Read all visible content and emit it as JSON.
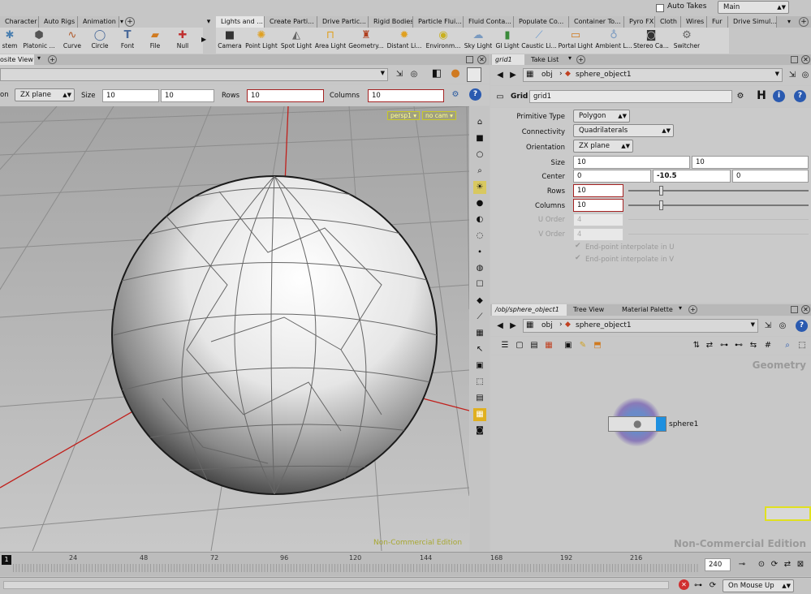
{
  "top_tabs_left": [
    "Character",
    "Auto Rigs",
    "Animation"
  ],
  "top_tabs_right": [
    "Lights and ...",
    "Create Parti...",
    "Drive Partic...",
    "Rigid Bodies",
    "Particle Flui...",
    "Fluid Conta...",
    "Populate Co...",
    "Container To...",
    "Pyro FX",
    "Cloth",
    "Wires",
    "Fur",
    "Drive Simul..."
  ],
  "auto_takes_label": "Auto Takes",
  "main_label": "Main",
  "tools_left": [
    {
      "label": "stem",
      "icon": "stem-icon"
    },
    {
      "label": "Platonic ...",
      "icon": "platonic-icon"
    },
    {
      "label": "Curve",
      "icon": "curve-icon"
    },
    {
      "label": "Circle",
      "icon": "circle-icon"
    },
    {
      "label": "Font",
      "icon": "font-icon"
    },
    {
      "label": "File",
      "icon": "file-icon"
    },
    {
      "label": "Null",
      "icon": "null-icon"
    }
  ],
  "tools_right": [
    {
      "label": "Camera",
      "icon": "camera-icon"
    },
    {
      "label": "Point Light",
      "icon": "point-light-icon"
    },
    {
      "label": "Spot Light",
      "icon": "spot-light-icon"
    },
    {
      "label": "Area Light",
      "icon": "area-light-icon"
    },
    {
      "label": "Geometry...",
      "icon": "geometry-light-icon"
    },
    {
      "label": "Distant Li...",
      "icon": "distant-light-icon"
    },
    {
      "label": "Environm...",
      "icon": "environment-light-icon"
    },
    {
      "label": "Sky Light",
      "icon": "sky-light-icon"
    },
    {
      "label": "GI Light",
      "icon": "gi-light-icon"
    },
    {
      "label": "Caustic Li...",
      "icon": "caustic-light-icon"
    },
    {
      "label": "Portal Light",
      "icon": "portal-light-icon"
    },
    {
      "label": "Ambient L...",
      "icon": "ambient-light-icon"
    },
    {
      "label": "Stereo Ca...",
      "icon": "stereo-camera-icon"
    },
    {
      "label": "Switcher",
      "icon": "switcher-icon"
    }
  ],
  "viewport": {
    "tab_label": "osite View",
    "plane": "ZX plane",
    "size_label": "Size",
    "size": [
      "10",
      "10"
    ],
    "rows_label": "Rows",
    "rows": "10",
    "columns_label": "Columns",
    "columns": "10",
    "on_label": "on",
    "persp": "persp1",
    "cam": "no cam",
    "watermark": "Non-Commercial Edition"
  },
  "params": {
    "tabs": [
      "grid1",
      "Take List"
    ],
    "path": "obj",
    "object": "sphere_object1",
    "node_type": "Grid",
    "node_name": "grid1",
    "primitive_type_label": "Primitive Type",
    "primitive_type": "Polygon",
    "connectivity_label": "Connectivity",
    "connectivity": "Quadrilaterals",
    "orientation_label": "Orientation",
    "orientation": "ZX plane",
    "size_label": "Size",
    "size": [
      "10",
      "10"
    ],
    "center_label": "Center",
    "center": [
      "0",
      "-10.5",
      "0"
    ],
    "rows_label": "Rows",
    "rows": "10",
    "columns_label": "Columns",
    "columns": "10",
    "u_order_label": "U Order",
    "u_order": "4",
    "v_order_label": "V Order",
    "v_order": "4",
    "endpoint_u": "End-point interpolate in U",
    "endpoint_v": "End-point interpolate in V"
  },
  "network": {
    "tabs": [
      "/obj/sphere_object1",
      "Tree View",
      "Material Palette"
    ],
    "path": "obj",
    "object": "sphere_object1",
    "context_label": "Geometry",
    "node_label": "sphere1",
    "watermark": "Non-Commercial Edition"
  },
  "timeline": {
    "current_frame": "1",
    "ticks": [
      "24",
      "48",
      "72",
      "96",
      "120",
      "144",
      "168",
      "192",
      "216"
    ],
    "end_frame": "240",
    "update_mode": "On Mouse Up"
  }
}
